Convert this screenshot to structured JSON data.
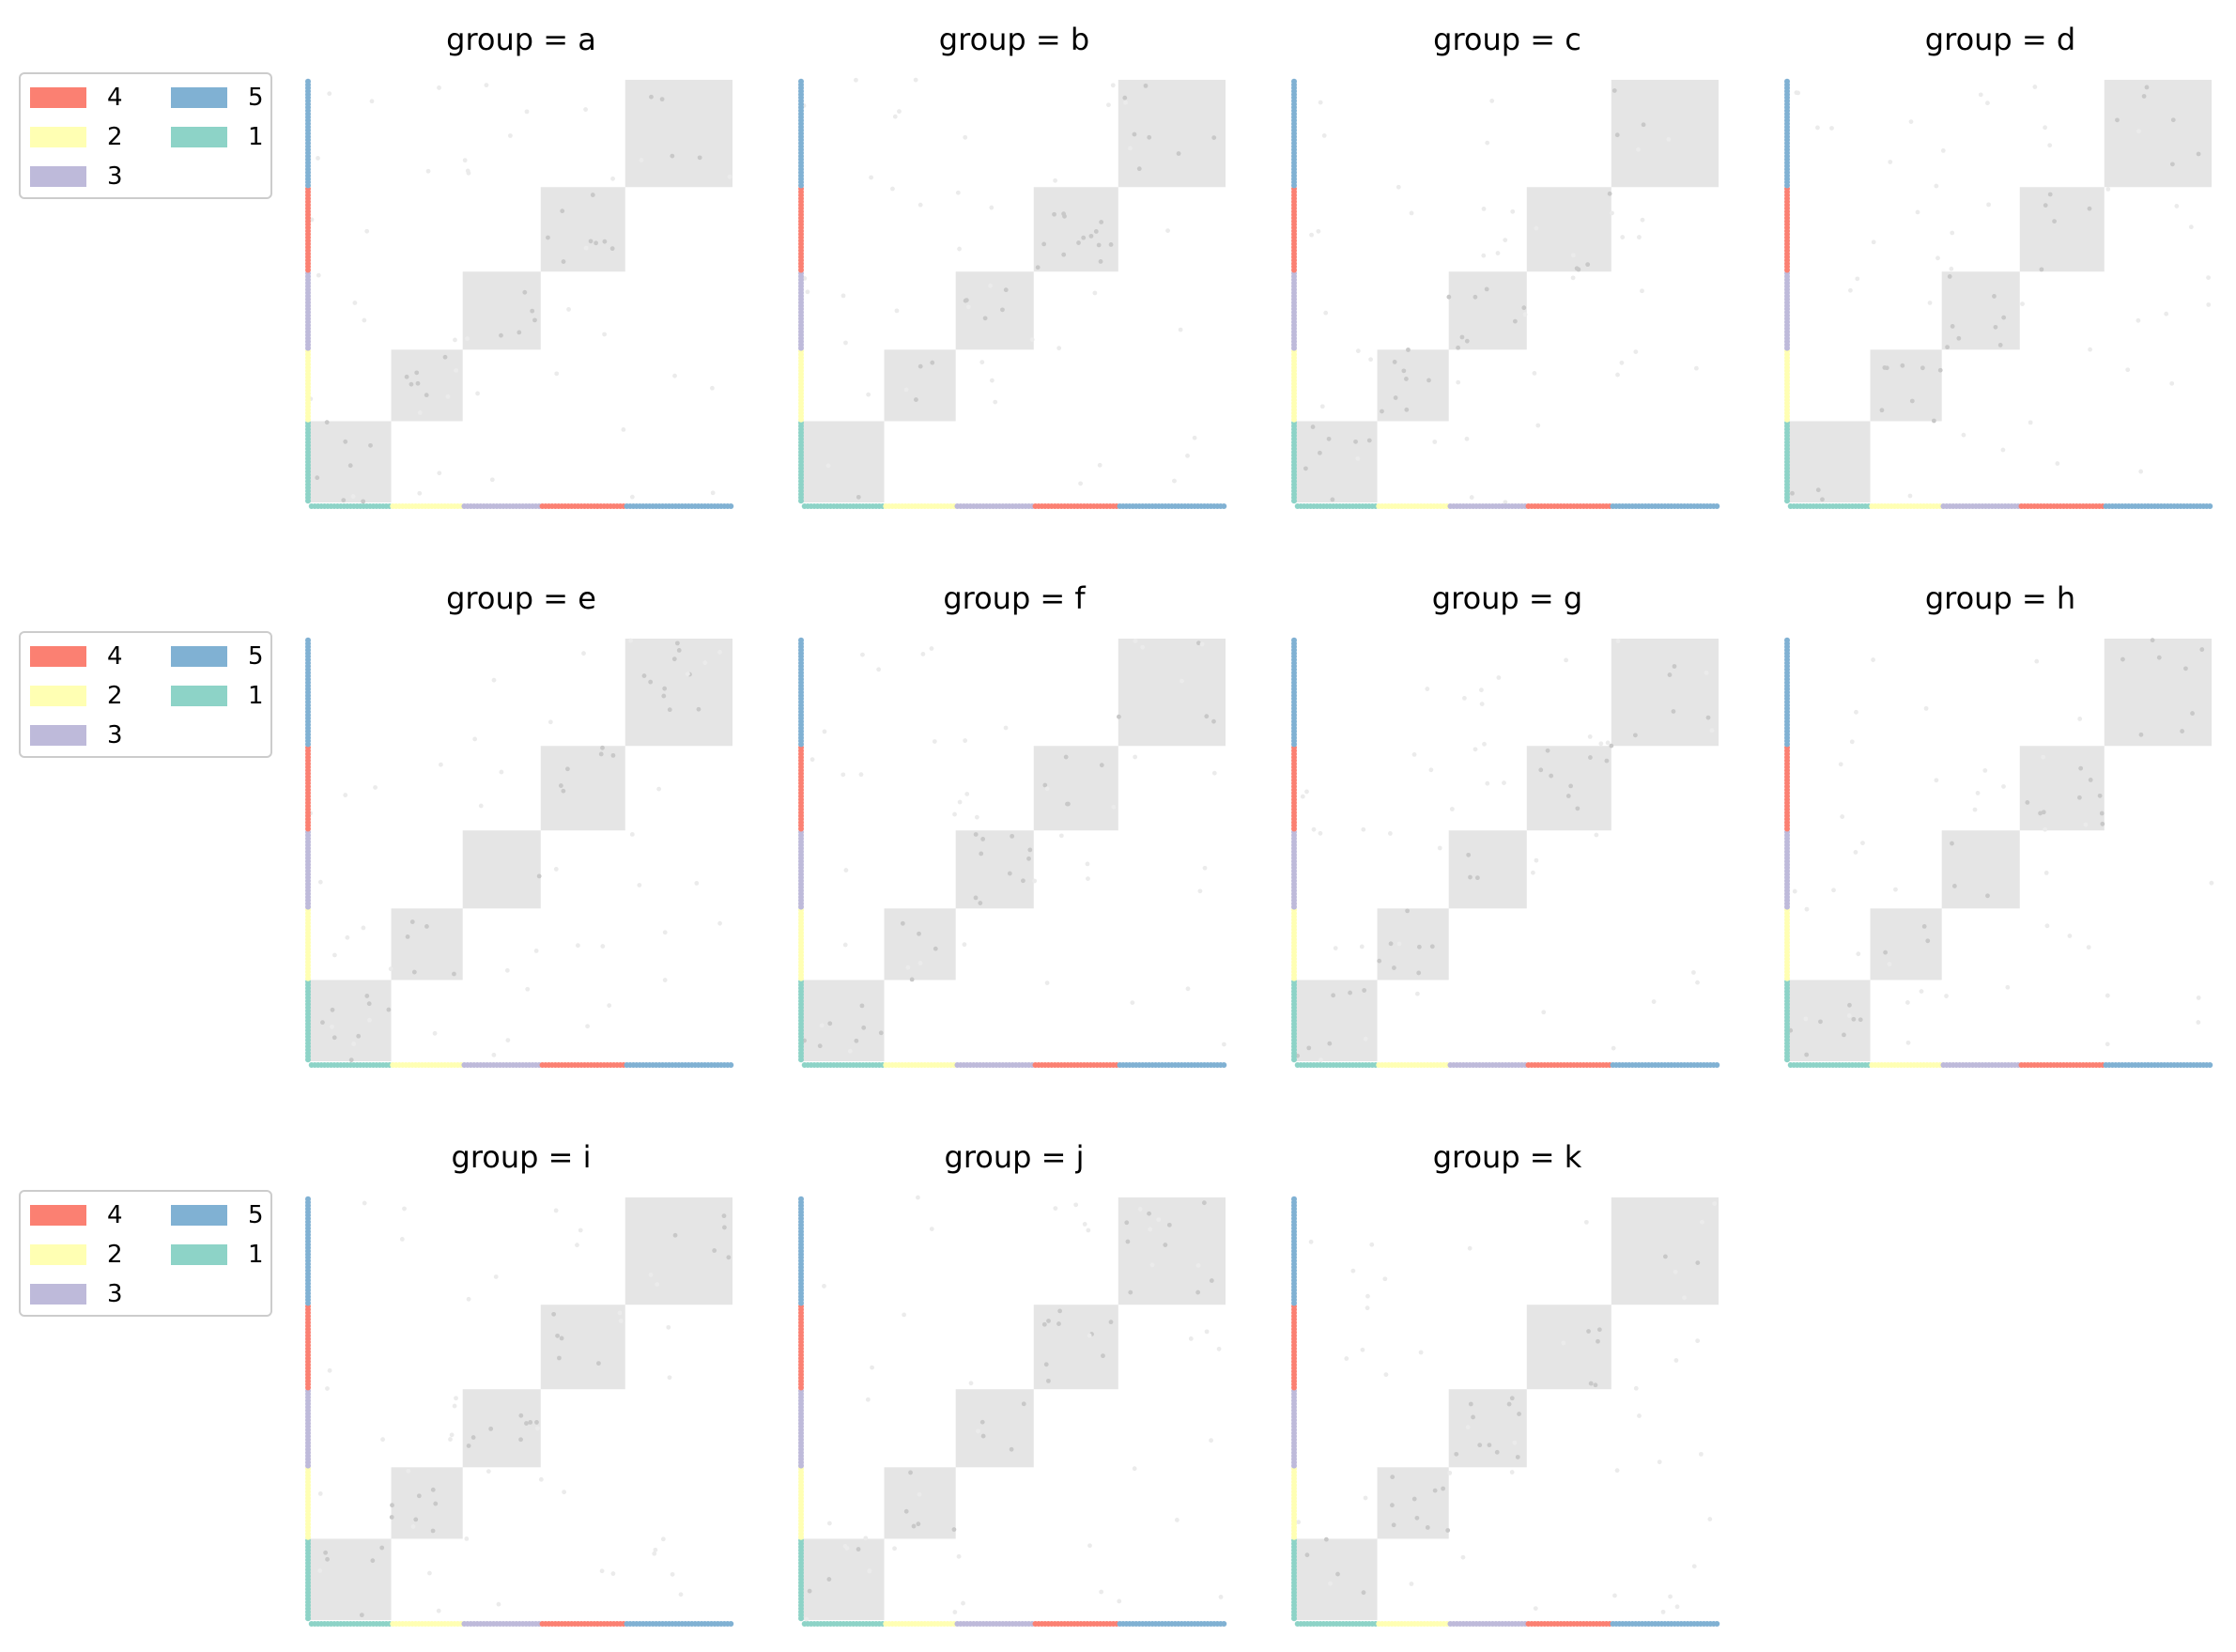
{
  "chart_data": {
    "type": "heatmap",
    "description_type": "facet-grid-adjacency",
    "facet_label_prefix": "group = ",
    "facets": [
      "a",
      "b",
      "c",
      "d",
      "e",
      "f",
      "g",
      "h",
      "i",
      "j",
      "k"
    ],
    "community_order": [
      "1",
      "2",
      "3",
      "4",
      "5"
    ],
    "community_sizes": {
      "1": 25,
      "2": 22,
      "3": 24,
      "4": 26,
      "5": 33
    },
    "legend": {
      "entries": [
        {
          "label": "4",
          "color": "#fb8072"
        },
        {
          "label": "5",
          "color": "#80b1d3"
        },
        {
          "label": "2",
          "color": "#ffffb3"
        },
        {
          "label": "1",
          "color": "#8dd3c7"
        },
        {
          "label": "3",
          "color": "#bebada"
        }
      ],
      "placement": "left of each row"
    },
    "block_color": "#e5e5e5",
    "edge_color": "#cccccc",
    "grid": false,
    "axes_visible": false
  }
}
